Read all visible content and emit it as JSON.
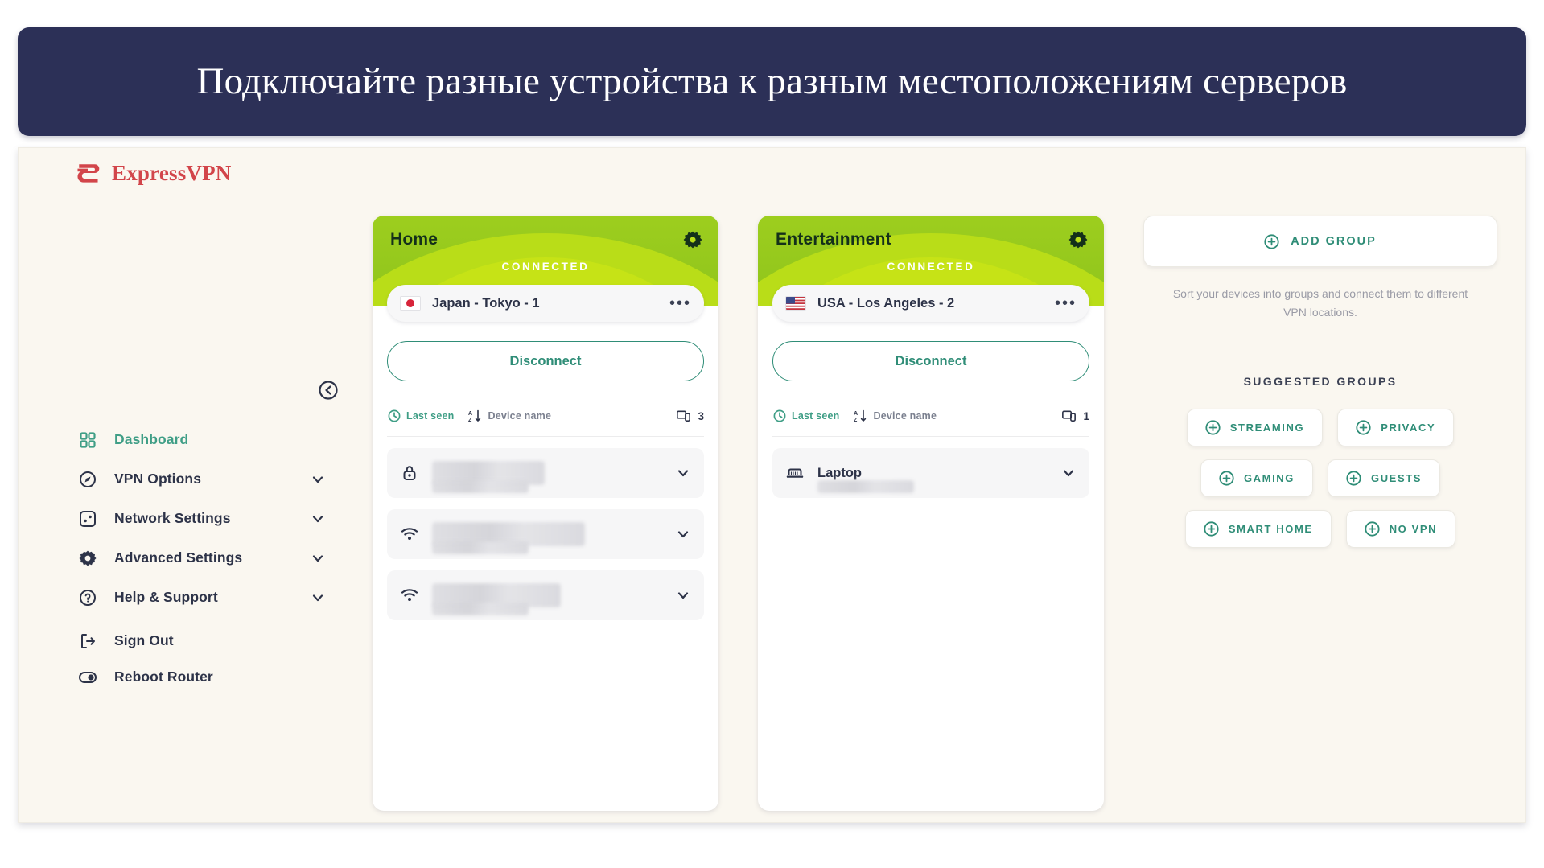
{
  "banner": {
    "title": "Подключайте разные устройства к разным местоположениям серверов",
    "bg_color": "#2c3057",
    "text_color": "#ffffff"
  },
  "app": {
    "bg_color": "#faf7f0",
    "accent_green": "#2f8d77",
    "brand_red": "#d2454a"
  },
  "sidebar": {
    "logo_text": "ExpressVPN",
    "collapse_icon": "circle-arrow-left-icon",
    "items": [
      {
        "label": "Dashboard",
        "icon": "grid-icon",
        "active": true,
        "has_chevron": false
      },
      {
        "label": "VPN Options",
        "icon": "compass-icon",
        "active": false,
        "has_chevron": true
      },
      {
        "label": "Network Settings",
        "icon": "network-icon",
        "active": false,
        "has_chevron": true
      },
      {
        "label": "Advanced Settings",
        "icon": "gear-icon",
        "active": false,
        "has_chevron": true
      },
      {
        "label": "Help & Support",
        "icon": "question-circle-icon",
        "active": false,
        "has_chevron": true
      }
    ],
    "lower_items": [
      {
        "label": "Sign Out",
        "icon": "logout-icon"
      },
      {
        "label": "Reboot Router",
        "icon": "power-toggle-icon"
      }
    ]
  },
  "cards": [
    {
      "title": "Home",
      "status": "CONNECTED",
      "gear_icon": "gear-icon",
      "flag": "japan-flag",
      "location": "Japan - Tokyo - 1",
      "menu_icon": "more-options-icon",
      "disconnect_label": "Disconnect",
      "sort": {
        "last_seen_label": "Last seen",
        "last_seen_icon": "clock-icon",
        "device_name_label": "Device name",
        "device_name_icon": "sort-az-icon",
        "count_icon": "devices-icon",
        "count": "3",
        "active": "last_seen"
      },
      "devices": [
        {
          "name": "",
          "icon": "lock-icon",
          "redacted": true,
          "chevron": "chevron-down-icon"
        },
        {
          "name": "",
          "icon": "wifi-icon",
          "redacted": true,
          "chevron": "chevron-down-icon"
        },
        {
          "name": "",
          "icon": "wifi-icon",
          "redacted": true,
          "chevron": "chevron-down-icon"
        }
      ]
    },
    {
      "title": "Entertainment",
      "status": "CONNECTED",
      "gear_icon": "gear-icon",
      "flag": "usa-flag",
      "location": "USA - Los Angeles - 2",
      "menu_icon": "more-options-icon",
      "disconnect_label": "Disconnect",
      "sort": {
        "last_seen_label": "Last seen",
        "last_seen_icon": "clock-icon",
        "device_name_label": "Device name",
        "device_name_icon": "sort-az-icon",
        "count_icon": "devices-icon",
        "count": "1",
        "active": "last_seen"
      },
      "devices": [
        {
          "name": "Laptop",
          "icon": "laptop-icon",
          "redacted": false,
          "chevron": "chevron-down-icon"
        }
      ]
    }
  ],
  "right_panel": {
    "add_group_label": "ADD GROUP",
    "add_group_icon": "plus-circle-icon",
    "helper_text": "Sort your devices into groups and connect them to different VPN locations.",
    "suggested_title": "SUGGESTED GROUPS",
    "chips": [
      {
        "label": "STREAMING",
        "icon": "plus-circle-icon"
      },
      {
        "label": "PRIVACY",
        "icon": "plus-circle-icon"
      },
      {
        "label": "GAMING",
        "icon": "plus-circle-icon"
      },
      {
        "label": "GUESTS",
        "icon": "plus-circle-icon"
      },
      {
        "label": "SMART HOME",
        "icon": "plus-circle-icon"
      },
      {
        "label": "NO VPN",
        "icon": "plus-circle-icon"
      }
    ]
  }
}
